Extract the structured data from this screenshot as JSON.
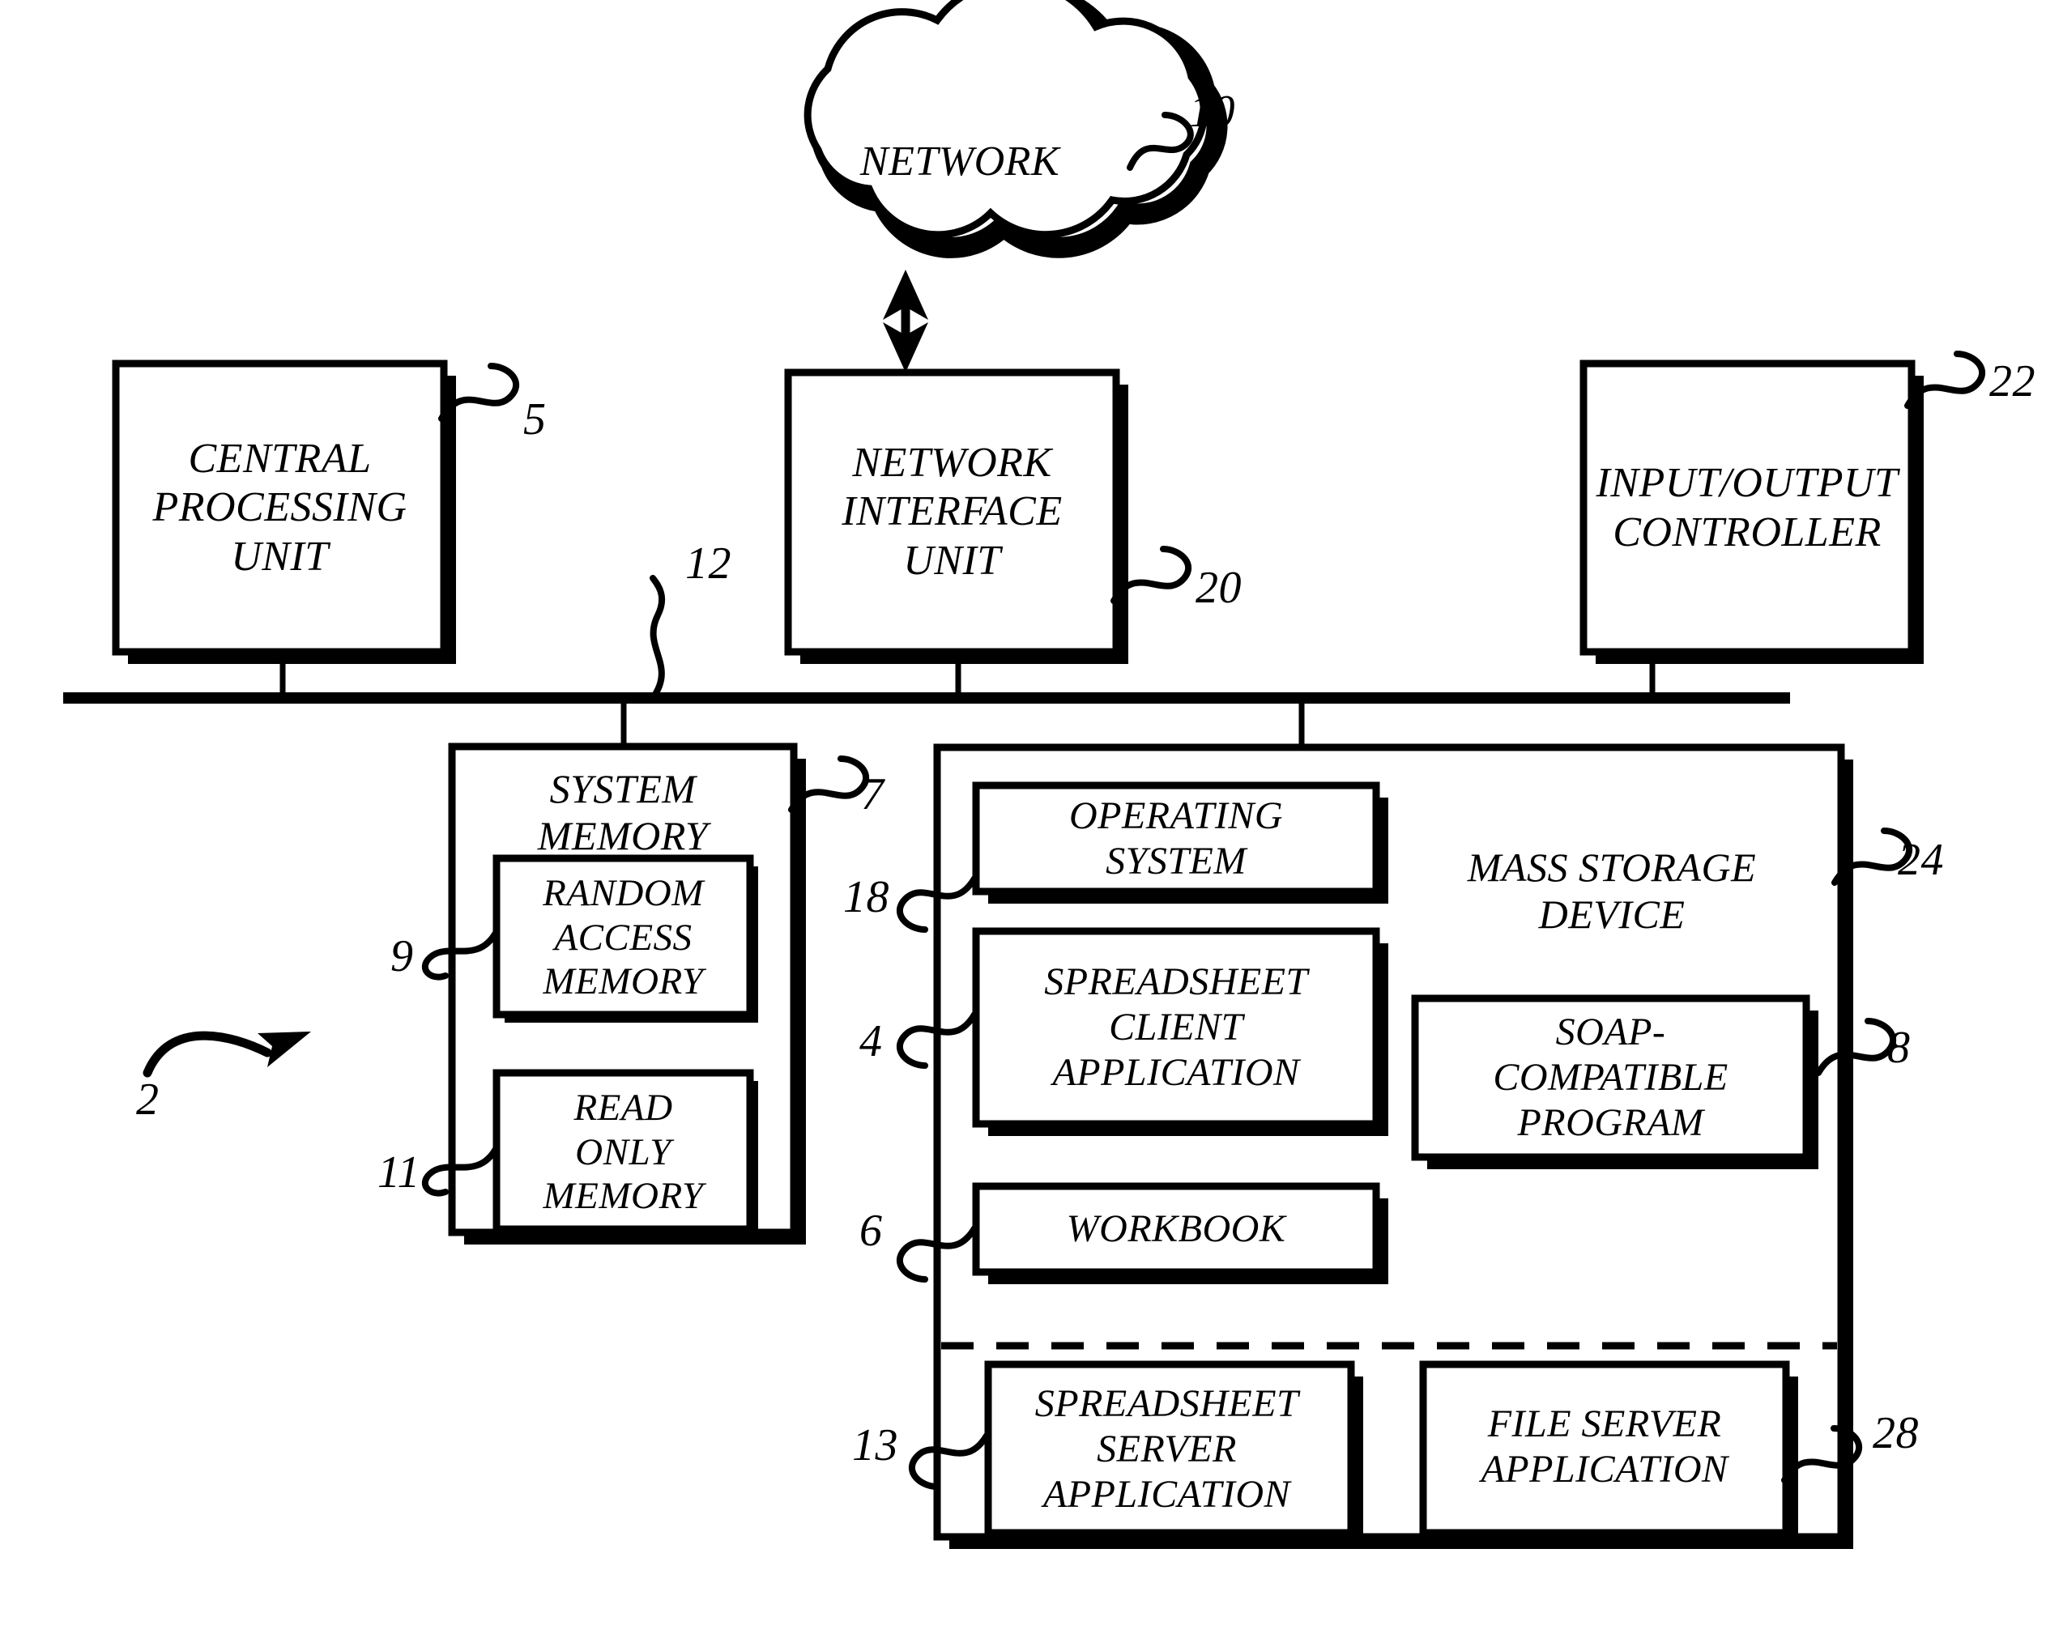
{
  "figure": {
    "type": "patent-block-diagram",
    "overall_ref": "2",
    "background_color": "#ffffff",
    "line_color": "#000000"
  },
  "cloud": {
    "label": "NETWORK",
    "ref": "10"
  },
  "bus": {
    "ref": "12"
  },
  "blocks": [
    {
      "id": "cpu",
      "label": "CENTRAL\nPROCESSING\nUNIT",
      "ref": "5"
    },
    {
      "id": "niu",
      "label": "NETWORK\nINTERFACE\nUNIT",
      "ref": "20"
    },
    {
      "id": "ioc",
      "label": "INPUT/OUTPUT\nCONTROLLER",
      "ref": "22"
    },
    {
      "id": "sysmem",
      "label": "SYSTEM\nMEMORY",
      "ref": "7"
    },
    {
      "id": "ram",
      "label": "RANDOM\nACCESS\nMEMORY",
      "ref": "9"
    },
    {
      "id": "rom",
      "label": "READ\nONLY\nMEMORY",
      "ref": "11"
    },
    {
      "id": "mass",
      "label": "MASS STORAGE\nDEVICE",
      "ref": "24"
    },
    {
      "id": "os",
      "label": "OPERATING\nSYSTEM",
      "ref": "18"
    },
    {
      "id": "sca",
      "label": "SPREADSHEET\nCLIENT\nAPPLICATION",
      "ref": "4"
    },
    {
      "id": "wb",
      "label": "WORKBOOK",
      "ref": "6"
    },
    {
      "id": "soap",
      "label": "SOAP-\nCOMPATIBLE\nPROGRAM",
      "ref": "8"
    },
    {
      "id": "ssa",
      "label": "SPREADSHEET\nSERVER\nAPPLICATION",
      "ref": "13"
    },
    {
      "id": "fsa",
      "label": "FILE SERVER\nAPPLICATION",
      "ref": "28"
    }
  ]
}
